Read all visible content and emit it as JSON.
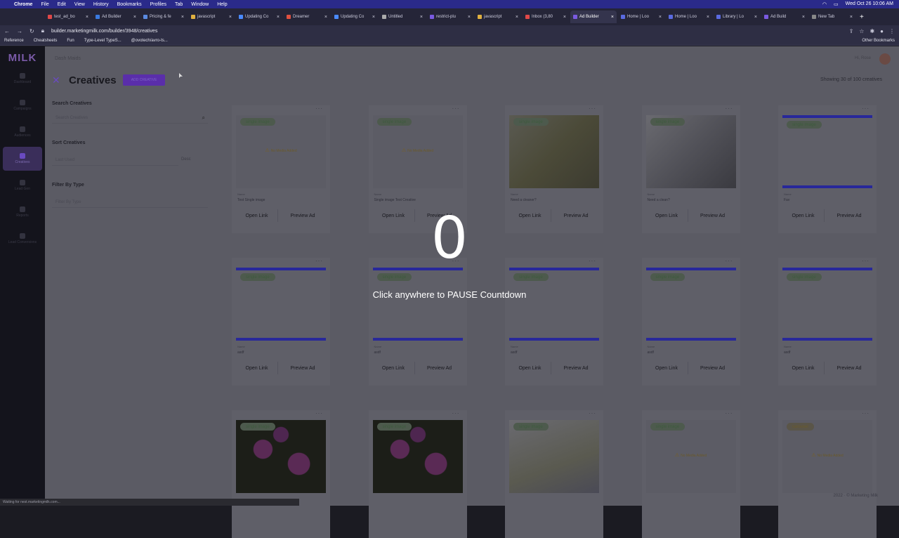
{
  "mac": {
    "app": "Chrome",
    "menus": [
      "File",
      "Edit",
      "View",
      "History",
      "Bookmarks",
      "Profiles",
      "Tab",
      "Window",
      "Help"
    ],
    "clock": "Wed Oct 26  10:06 AM"
  },
  "tabs": [
    "test_ad_bo",
    "Ad Builder",
    "Pricing & fe",
    "javascript",
    "Updating Co",
    "Dreamer",
    "Updating Co",
    "Untitled",
    "restrict-plu",
    "javascript",
    "Inbox (3,80",
    "Ad Builder",
    "Home | Loo",
    "Home | Loo",
    "Library | Lo",
    "Ad Build",
    "New Tab"
  ],
  "active_tab": 11,
  "address": "builder.marketingmilk.com/builder/3948/creatives",
  "bookmarks": [
    "Reference",
    "Cheatsheets",
    "Fun",
    "Type-Level TypeS...",
    "@ovotech/avro-ts..."
  ],
  "other_bookmarks": "Other Bookmarks",
  "app": {
    "logo": "MILK",
    "rail": [
      "Dashboard",
      "Campaigns",
      "Audiences",
      "Creatives",
      "Lead Gen",
      "Reports",
      "Lead Conversions"
    ],
    "breadcrumb": "Dash Maids",
    "greeting": "Hi, Rose",
    "title": "Creatives",
    "add_button": "ADD CREATIVE",
    "search_label": "Search Creatives",
    "search_placeholder": "Search Creatives",
    "sort_label": "Sort Creatives",
    "sort_value": "Last Used",
    "sort_dir": "Desc",
    "filter_label": "Filter By Type",
    "filter_placeholder": "Filter By Type",
    "count": "Showing 30 of 100 creatives",
    "name_label": "Name",
    "open_label": "Open Link",
    "preview_label": "Preview Ad",
    "no_media": "No Media Added",
    "footer": "2022 · © Marketing Milk"
  },
  "cards": [
    {
      "badge": "single image",
      "thumb": "empty",
      "name": "Test Single image",
      "nomedia": true
    },
    {
      "badge": "single image",
      "thumb": "empty",
      "name": "Single image Test Creative",
      "nomedia": true
    },
    {
      "badge": "single image",
      "thumb": "cleaner",
      "name": "Need a cleaner?",
      "nomedia": false
    },
    {
      "badge": "single image",
      "thumb": "kitchen",
      "name": "Need a clean?",
      "nomedia": false
    },
    {
      "badge": "single image",
      "thumb": "oven",
      "name": "Fav",
      "nomedia": false
    },
    {
      "badge": "single image",
      "thumb": "oven",
      "name": "asdf",
      "nomedia": false
    },
    {
      "badge": "single image",
      "thumb": "city",
      "name": "asdf",
      "nomedia": false
    },
    {
      "badge": "single image",
      "thumb": "kitchen",
      "name": "asdf",
      "nomedia": false
    },
    {
      "badge": "single image",
      "thumb": "oven",
      "name": "asdf",
      "nomedia": false
    },
    {
      "badge": "single image",
      "thumb": "kitchen",
      "name": "asdf",
      "nomedia": false
    },
    {
      "badge": "single image",
      "thumb": "flowers",
      "name": "",
      "nomedia": false
    },
    {
      "badge": "single image",
      "thumb": "flowers",
      "name": "",
      "nomedia": false
    },
    {
      "badge": "single image",
      "thumb": "woman",
      "name": "",
      "nomedia": false
    },
    {
      "badge": "single image",
      "thumb": "empty",
      "name": "",
      "nomedia": true
    },
    {
      "badge": "carousel",
      "thumb": "empty",
      "name": "",
      "nomedia": true
    }
  ],
  "overlay": {
    "number": "0",
    "message": "Click anywhere to PAUSE Countdown"
  },
  "status": "Waiting for nest.marketingmilk.com..."
}
